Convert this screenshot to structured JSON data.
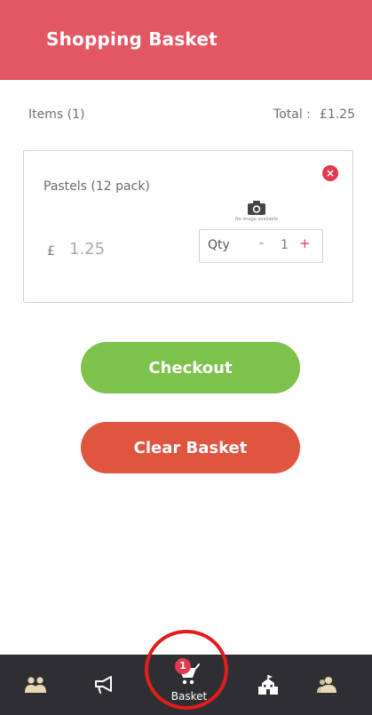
{
  "header": {
    "title": "Shopping Basket"
  },
  "summary": {
    "items_label": "Items (1)",
    "total_label": "Total :",
    "total_value": "£1.25"
  },
  "basket_item": {
    "name": "Pastels (12 pack)",
    "image_caption": "No image available",
    "currency_symbol": "£",
    "price": "1.25",
    "qty_label": "Qty",
    "minus": "-",
    "quantity": "1",
    "plus": "+",
    "remove_icon": "×"
  },
  "actions": {
    "checkout_label": "Checkout",
    "clear_label": "Clear Basket"
  },
  "tabbar": {
    "basket_badge": "1",
    "basket_label": "Basket",
    "icons": [
      "people-icon",
      "megaphone-icon",
      "basket-icon",
      "school-icon",
      "profile-icon"
    ]
  },
  "colors": {
    "header": "#e35762",
    "checkout": "#7dc24b",
    "clear": "#e0553f",
    "tabbar": "#2f2f33",
    "accent_red": "#e2394e",
    "highlight_ring": "#e41c1c"
  }
}
